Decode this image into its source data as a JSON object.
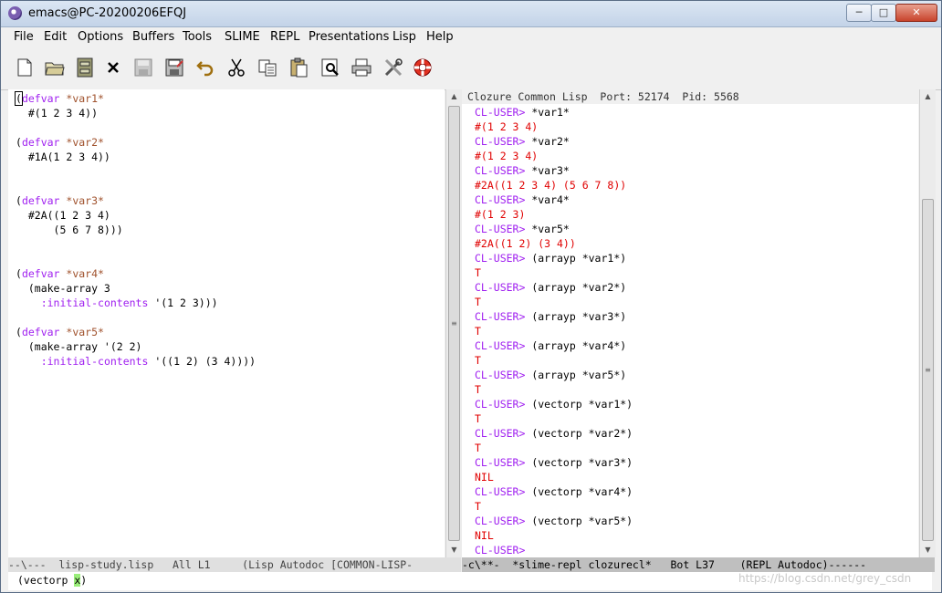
{
  "window": {
    "title": "emacs@PC-20200206EFQJ",
    "min_label": "─",
    "max_label": "□",
    "close_label": "✕"
  },
  "menu": [
    "File",
    "Edit",
    "Options",
    "Buffers",
    "Tools",
    "SLIME",
    "REPL",
    "Presentations",
    "Lisp",
    "Help"
  ],
  "toolbar_icons": [
    "new-file-icon",
    "open-folder-icon",
    "save-cabinet-icon",
    "close-x-icon",
    "save-disk-icon",
    "save-as-icon",
    "undo-icon",
    "cut-icon",
    "copy-icon",
    "paste-icon",
    "search-icon",
    "print-icon",
    "preferences-icon",
    "help-lifebuoy-icon"
  ],
  "editor": {
    "lines": [
      [
        {
          "t": "(",
          "c": "inp"
        },
        {
          "t": "defvar",
          "c": "kw"
        },
        {
          "t": " *var1*",
          "c": "var"
        }
      ],
      [
        {
          "t": "  #(1 2 3 4))",
          "c": "inp"
        }
      ],
      [],
      [
        {
          "t": "(",
          "c": "inp"
        },
        {
          "t": "defvar",
          "c": "kw"
        },
        {
          "t": " *var2*",
          "c": "var"
        }
      ],
      [
        {
          "t": "  #1A(1 2 3 4))",
          "c": "inp"
        }
      ],
      [],
      [],
      [
        {
          "t": "(",
          "c": "inp"
        },
        {
          "t": "defvar",
          "c": "kw"
        },
        {
          "t": " *var3*",
          "c": "var"
        }
      ],
      [
        {
          "t": "  #2A((1 2 3 4)",
          "c": "inp"
        }
      ],
      [
        {
          "t": "      (5 6 7 8)))",
          "c": "inp"
        }
      ],
      [],
      [],
      [
        {
          "t": "(",
          "c": "inp"
        },
        {
          "t": "defvar",
          "c": "kw"
        },
        {
          "t": " *var4*",
          "c": "var"
        }
      ],
      [
        {
          "t": "  (make-array 3",
          "c": "inp"
        }
      ],
      [
        {
          "t": "    ",
          "c": "inp"
        },
        {
          "t": ":initial-contents",
          "c": "kwarg"
        },
        {
          "t": " '(1 2 3)))",
          "c": "inp"
        }
      ],
      [],
      [
        {
          "t": "(",
          "c": "inp"
        },
        {
          "t": "defvar",
          "c": "kw"
        },
        {
          "t": " *var5*",
          "c": "var"
        }
      ],
      [
        {
          "t": "  (make-array '(2 2)",
          "c": "inp"
        }
      ],
      [
        {
          "t": "    ",
          "c": "inp"
        },
        {
          "t": ":initial-contents",
          "c": "kwarg"
        },
        {
          "t": " '((1 2) (3 4))))",
          "c": "inp"
        }
      ]
    ]
  },
  "repl": {
    "header": "Clozure Common Lisp  Port: 52174  Pid: 5568",
    "lines": [
      [
        {
          "t": "CL-USER> ",
          "c": "prompt"
        },
        {
          "t": "*var1*",
          "c": "inp"
        }
      ],
      [
        {
          "t": "#(1 2 3 4)",
          "c": "res"
        }
      ],
      [
        {
          "t": "CL-USER> ",
          "c": "prompt"
        },
        {
          "t": "*var2*",
          "c": "inp"
        }
      ],
      [
        {
          "t": "#(1 2 3 4)",
          "c": "res"
        }
      ],
      [
        {
          "t": "CL-USER> ",
          "c": "prompt"
        },
        {
          "t": "*var3*",
          "c": "inp"
        }
      ],
      [
        {
          "t": "#2A((1 2 3 4) (5 6 7 8))",
          "c": "res"
        }
      ],
      [
        {
          "t": "CL-USER> ",
          "c": "prompt"
        },
        {
          "t": "*var4*",
          "c": "inp"
        }
      ],
      [
        {
          "t": "#(1 2 3)",
          "c": "res"
        }
      ],
      [
        {
          "t": "CL-USER> ",
          "c": "prompt"
        },
        {
          "t": "*var5*",
          "c": "inp"
        }
      ],
      [
        {
          "t": "#2A((1 2) (3 4))",
          "c": "res"
        }
      ],
      [
        {
          "t": "CL-USER> ",
          "c": "prompt"
        },
        {
          "t": "(arrayp *var1*)",
          "c": "inp"
        }
      ],
      [
        {
          "t": "T",
          "c": "res"
        }
      ],
      [
        {
          "t": "CL-USER> ",
          "c": "prompt"
        },
        {
          "t": "(arrayp *var2*)",
          "c": "inp"
        }
      ],
      [
        {
          "t": "T",
          "c": "res"
        }
      ],
      [
        {
          "t": "CL-USER> ",
          "c": "prompt"
        },
        {
          "t": "(arrayp *var3*)",
          "c": "inp"
        }
      ],
      [
        {
          "t": "T",
          "c": "res"
        }
      ],
      [
        {
          "t": "CL-USER> ",
          "c": "prompt"
        },
        {
          "t": "(arrayp *var4*)",
          "c": "inp"
        }
      ],
      [
        {
          "t": "T",
          "c": "res"
        }
      ],
      [
        {
          "t": "CL-USER> ",
          "c": "prompt"
        },
        {
          "t": "(arrayp *var5*)",
          "c": "inp"
        }
      ],
      [
        {
          "t": "T",
          "c": "res"
        }
      ],
      [
        {
          "t": "CL-USER> ",
          "c": "prompt"
        },
        {
          "t": "(vectorp *var1*)",
          "c": "inp"
        }
      ],
      [
        {
          "t": "T",
          "c": "res"
        }
      ],
      [
        {
          "t": "CL-USER> ",
          "c": "prompt"
        },
        {
          "t": "(vectorp *var2*)",
          "c": "inp"
        }
      ],
      [
        {
          "t": "T",
          "c": "res"
        }
      ],
      [
        {
          "t": "CL-USER> ",
          "c": "prompt"
        },
        {
          "t": "(vectorp *var3*)",
          "c": "inp"
        }
      ],
      [
        {
          "t": "NIL",
          "c": "res"
        }
      ],
      [
        {
          "t": "CL-USER> ",
          "c": "prompt"
        },
        {
          "t": "(vectorp *var4*)",
          "c": "inp"
        }
      ],
      [
        {
          "t": "T",
          "c": "res"
        }
      ],
      [
        {
          "t": "CL-USER> ",
          "c": "prompt"
        },
        {
          "t": "(vectorp *var5*)",
          "c": "inp"
        }
      ],
      [
        {
          "t": "NIL",
          "c": "res"
        }
      ],
      [
        {
          "t": "CL-USER> ",
          "c": "prompt"
        }
      ]
    ]
  },
  "modeline_left": "--\\---  lisp-study.lisp   All L1     (Lisp Autodoc [COMMON-LISP-",
  "modeline_right": "-c\\**-  *slime-repl clozurecl*   Bot L37    (REPL Autodoc)------",
  "minibuffer": {
    "before": "(vectorp ",
    "cursor_char": "x",
    "after": ")"
  },
  "watermark": "https://blog.csdn.net/grey_csdn"
}
